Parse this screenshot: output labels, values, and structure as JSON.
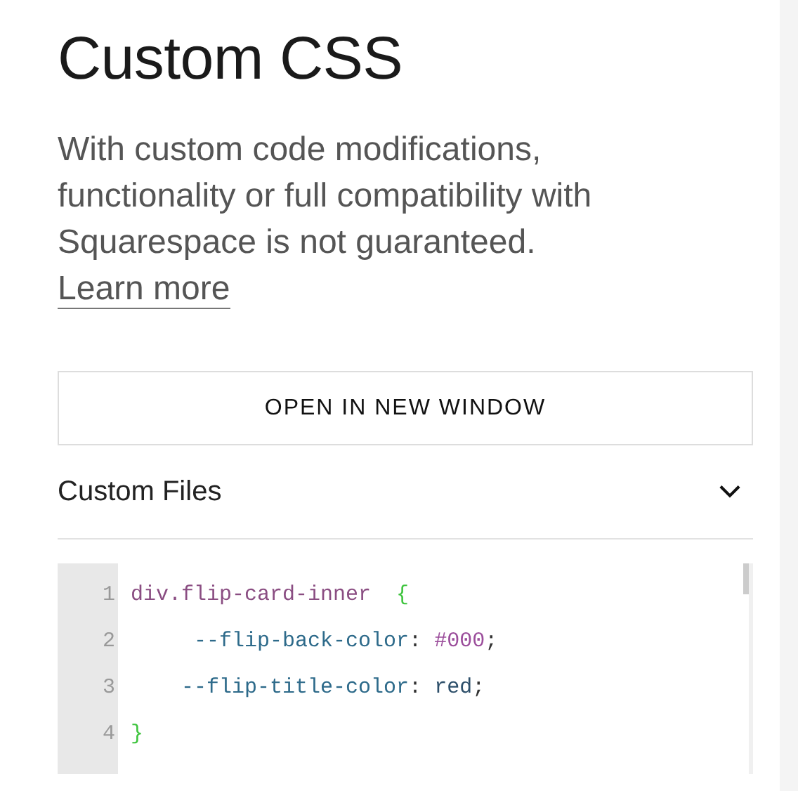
{
  "heading": "Custom CSS",
  "description": "With custom code modifications, functionality or full compatibility with Squarespace is not guaranteed.",
  "learn_more_link": "Learn more",
  "open_button": "OPEN IN NEW WINDOW",
  "section": {
    "title": "Custom Files",
    "expanded": false
  },
  "editor": {
    "lines": [
      {
        "number": "1",
        "tokens": [
          {
            "kind": "selector",
            "text": "div.flip-card-inner"
          },
          {
            "kind": "brace",
            "text": " {"
          }
        ]
      },
      {
        "number": "2",
        "tokens": [
          {
            "kind": "property",
            "text": "     --flip-back-color"
          },
          {
            "kind": "plain",
            "text": ": "
          },
          {
            "kind": "number",
            "text": "#000"
          },
          {
            "kind": "plain",
            "text": ";"
          }
        ]
      },
      {
        "number": "3",
        "tokens": [
          {
            "kind": "property",
            "text": "    --flip-title-color"
          },
          {
            "kind": "plain",
            "text": ": "
          },
          {
            "kind": "value",
            "text": "red"
          },
          {
            "kind": "plain",
            "text": ";"
          }
        ]
      },
      {
        "number": "4",
        "tokens": [
          {
            "kind": "brace",
            "text": "}"
          }
        ]
      }
    ]
  }
}
